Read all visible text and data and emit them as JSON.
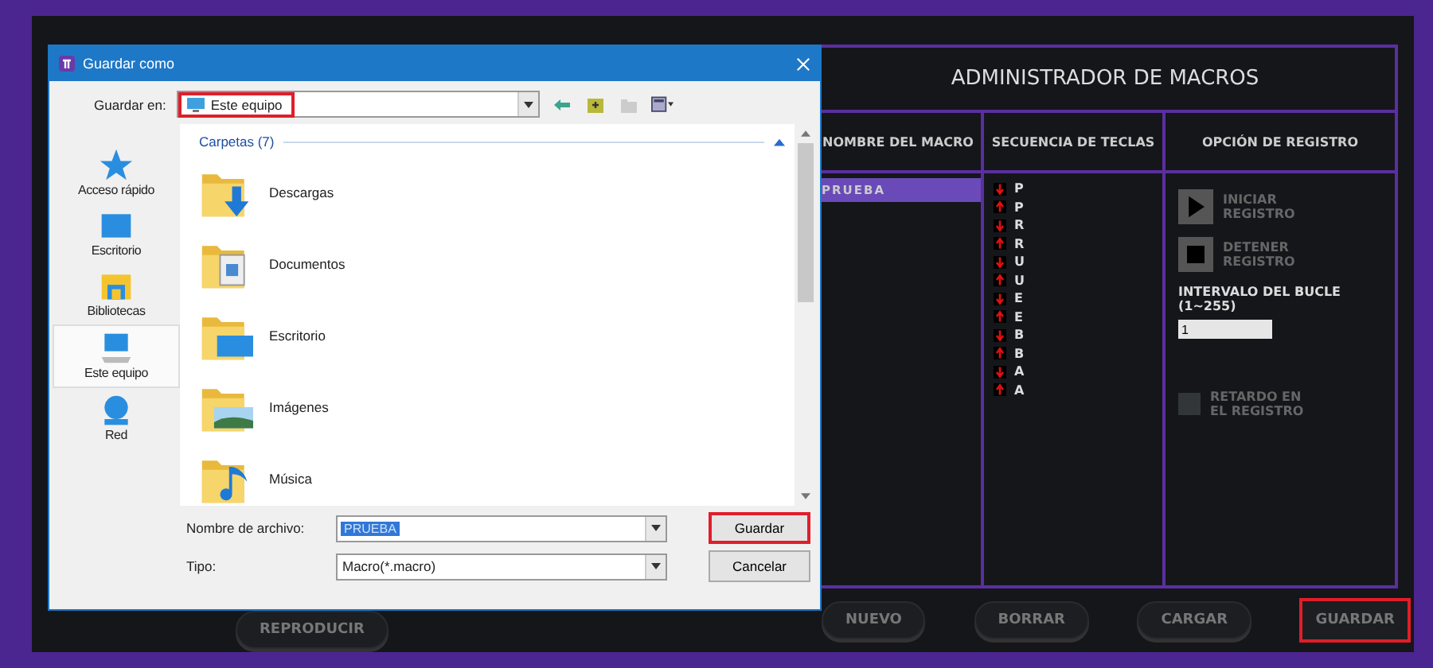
{
  "dialog": {
    "title": "Guardar como",
    "save_in": {
      "label": "Guardar en:",
      "value": "Este equipo",
      "highlighted": true
    },
    "places": [
      {
        "kind": "star",
        "label": "Acceso rápido",
        "selected": false
      },
      {
        "kind": "desktop",
        "label": "Escritorio",
        "selected": false
      },
      {
        "kind": "libraries",
        "label": "Bibliotecas",
        "selected": false
      },
      {
        "kind": "computer",
        "label": "Este equipo",
        "selected": true
      },
      {
        "kind": "network",
        "label": "Red",
        "selected": false
      }
    ],
    "section": "Carpetas (7)",
    "folders": [
      {
        "kind": "downloads",
        "name": "Descargas"
      },
      {
        "kind": "documents",
        "name": "Documentos"
      },
      {
        "kind": "desktop",
        "name": "Escritorio"
      },
      {
        "kind": "pictures",
        "name": "Imágenes"
      },
      {
        "kind": "music",
        "name": "Música"
      }
    ],
    "file_name": {
      "label": "Nombre de archivo:",
      "value": "PRUEBA"
    },
    "file_type": {
      "label": "Tipo:",
      "value": "Macro(*.macro)"
    },
    "buttons": [
      {
        "label": "Guardar",
        "highlighted": true
      },
      {
        "label": "Cancelar",
        "highlighted": false
      }
    ]
  },
  "macro_manager": {
    "title": "ADMINISTRADOR DE MACROS",
    "columns": [
      "NOMBRE DEL MACRO",
      "SECUENCIA DE TECLAS",
      "OPCIÓN DE REGISTRO"
    ],
    "macros": [
      {
        "name": "PRUEBA",
        "selected": true
      }
    ],
    "key_sequence": [
      {
        "kind": "press",
        "key": "P"
      },
      {
        "kind": "release",
        "key": "P"
      },
      {
        "kind": "press",
        "key": "R"
      },
      {
        "kind": "release",
        "key": "R"
      },
      {
        "kind": "press",
        "key": "U"
      },
      {
        "kind": "release",
        "key": "U"
      },
      {
        "kind": "press",
        "key": "E"
      },
      {
        "kind": "release",
        "key": "E"
      },
      {
        "kind": "press",
        "key": "B"
      },
      {
        "kind": "release",
        "key": "B"
      },
      {
        "kind": "press",
        "key": "A"
      },
      {
        "kind": "release",
        "key": "A"
      }
    ],
    "start_recording": "INICIAR REGISTRO",
    "stop_recording": "DETENER REGISTRO",
    "loop_label": "INTERVALO DEL BUCLE (1~255)",
    "loop_value": "1",
    "delay": {
      "label": "RETARDO EN EL REGISTRO",
      "checked": false
    },
    "play_button": "REPRODUCIR",
    "buttons": [
      {
        "label": "NUEVO",
        "highlighted": false
      },
      {
        "label": "BORRAR",
        "highlighted": false
      },
      {
        "label": "CARGAR",
        "highlighted": false
      },
      {
        "label": "GUARDAR",
        "highlighted": true
      }
    ]
  }
}
